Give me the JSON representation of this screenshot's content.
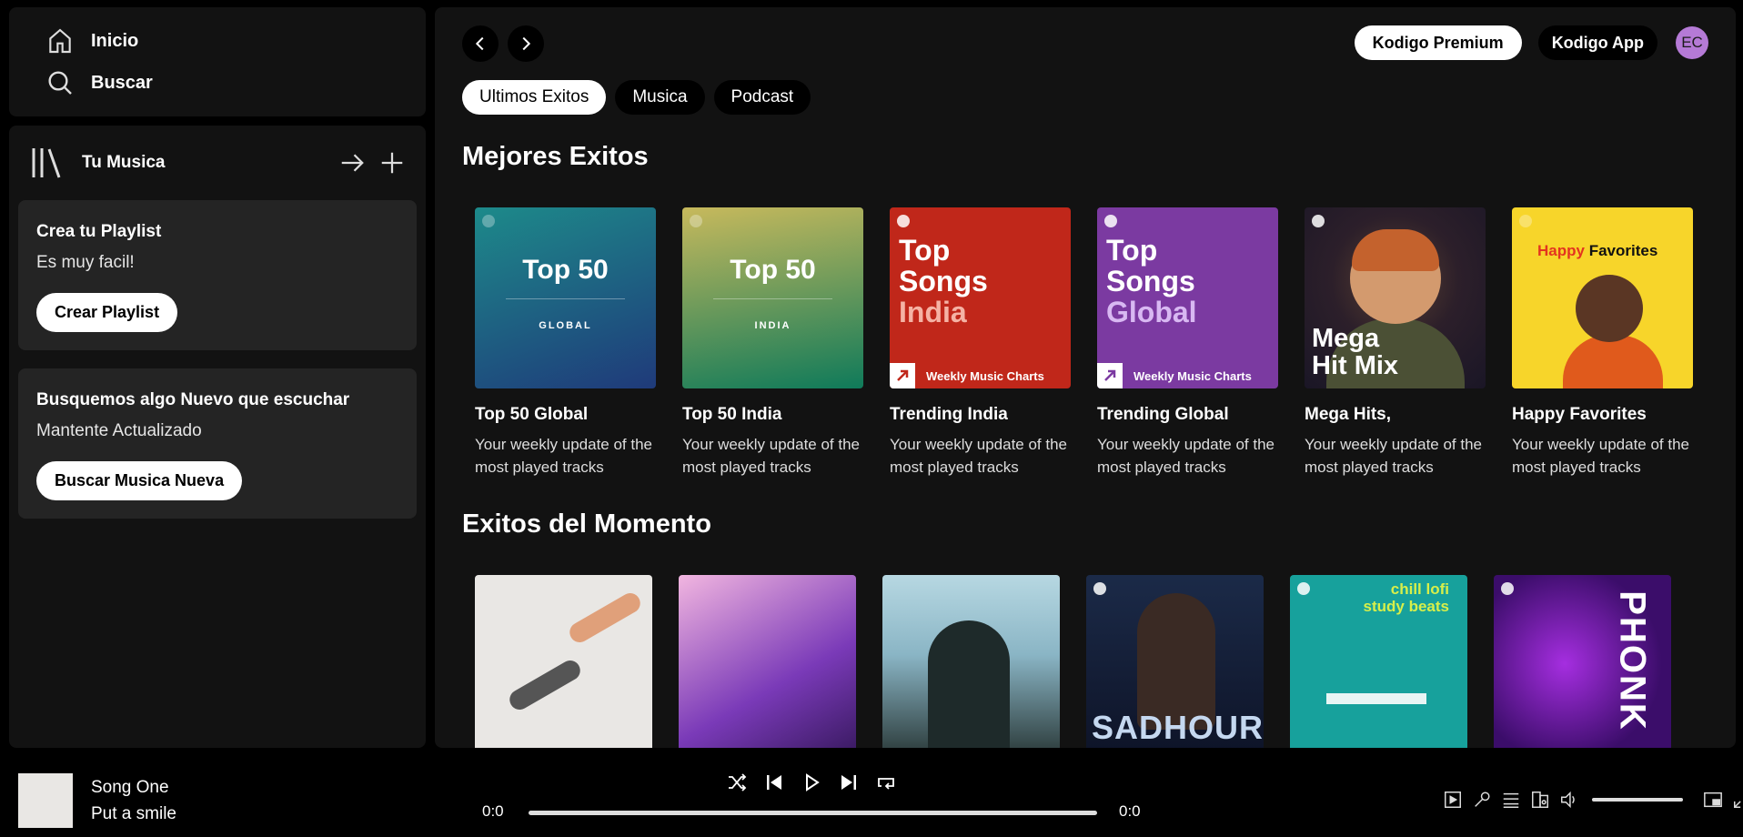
{
  "nav": {
    "home": "Inicio",
    "search": "Buscar"
  },
  "library": {
    "title": "Tu Musica",
    "promo1": {
      "title": "Crea tu Playlist",
      "text": "Es muy facil!",
      "button": "Crear Playlist"
    },
    "promo2": {
      "title": "Busquemos algo Nuevo que escuchar",
      "text": "Mantente Actualizado",
      "button": "Buscar Musica Nueva"
    }
  },
  "header": {
    "premium": "Kodigo Premium",
    "app": "Kodigo App",
    "avatar": "EC"
  },
  "chips": [
    "Ultimos Exitos",
    "Musica",
    "Podcast"
  ],
  "sections": {
    "best": "Mejores Exitos",
    "moment": "Exitos del Momento"
  },
  "cards": [
    {
      "title": "Top 50 Global",
      "desc": "Your weekly update of the most played tracks",
      "cover_main": "Top 50",
      "cover_sub": "GLOBAL"
    },
    {
      "title": "Top 50 India",
      "desc": "Your weekly update of the most played tracks",
      "cover_main": "Top 50",
      "cover_sub": "INDIA"
    },
    {
      "title": "Trending India",
      "desc": "Your weekly update of the most played tracks",
      "cover_l1": "Top",
      "cover_l2": "Songs",
      "cover_l3": "India",
      "cover_badge": "Weekly Music Charts"
    },
    {
      "title": "Trending Global",
      "desc": "Your weekly update of the most played tracks",
      "cover_l1": "Top",
      "cover_l2": "Songs",
      "cover_l3": "Global",
      "cover_badge": "Weekly Music Charts"
    },
    {
      "title": "Mega Hits,",
      "desc": "Your weekly update of the most played tracks",
      "cover_l1": "Mega",
      "cover_l2": "Hit Mix"
    },
    {
      "title": "Happy Favorites",
      "desc": "Your weekly update of the most played tracks",
      "cover_l1": "Happy",
      "cover_l2": "Favorites"
    }
  ],
  "moment_covers": {
    "chill_l1": "chill lofi",
    "chill_l2": "study beats",
    "sad": "SADHOUR",
    "phonk": "PHONK"
  },
  "player": {
    "title": "Song One",
    "artist": "Put a smile",
    "time_current": "0:0",
    "time_total": "0:0"
  }
}
